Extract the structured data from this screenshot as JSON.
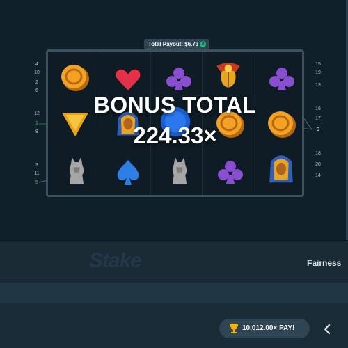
{
  "payout": {
    "label": "Total Payout: $6.73",
    "coin_icon": "tether-coin-icon",
    "coin_glyph": "₮"
  },
  "overlay": {
    "title": "BONUS TOTAL",
    "value": "224.33×"
  },
  "paylines_left": [
    "4",
    "10",
    "2",
    "6",
    "12",
    "1",
    "8",
    "3",
    "11",
    "5"
  ],
  "paylines_right": [
    "15",
    "19",
    "13",
    "16",
    "17",
    "9",
    "18",
    "20",
    "14"
  ],
  "win_lines": [
    "1",
    "5",
    "9"
  ],
  "symbols": [
    [
      "coin",
      "heart",
      "club",
      "scarab",
      "club"
    ],
    [
      "triangle",
      "pharaoh",
      "blue-coin",
      "coin",
      "coin"
    ],
    [
      "cat",
      "spade",
      "cat",
      "club",
      "pharaoh"
    ]
  ],
  "footer": {
    "logo": "Stake",
    "fairness": "Fairness"
  },
  "bottom": {
    "win_label": "10,012.00× PAY!",
    "trophy_icon": "trophy-icon",
    "chevron_icon": "chevron-left-icon"
  },
  "colors": {
    "background": "#1b2b36",
    "panel": "#10202b",
    "accent_green": "#1fb37b",
    "win_line": "#34d058"
  }
}
